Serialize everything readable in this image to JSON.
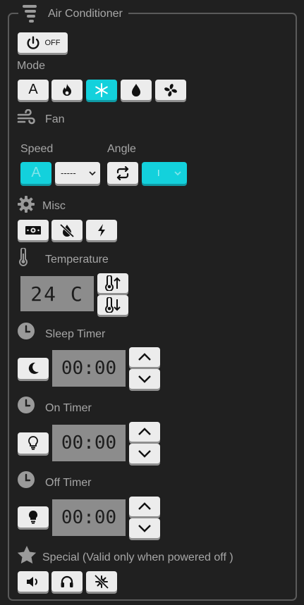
{
  "title": "Air Conditioner",
  "power": {
    "label": "OFF"
  },
  "mode": {
    "label": "Mode",
    "auto_label": "A",
    "selected": "cool"
  },
  "fan": {
    "label": "Fan",
    "speed_label": "Speed",
    "angle_label": "Angle",
    "speed_auto_label": "A",
    "angle_select_value": "-----",
    "angle_value_label": "I"
  },
  "misc": {
    "label": "Misc"
  },
  "temperature": {
    "label": "Temperature",
    "display": "24 C"
  },
  "sleep_timer": {
    "label": "Sleep Timer",
    "display": "00:00"
  },
  "on_timer": {
    "label": "On Timer",
    "display": "00:00"
  },
  "off_timer": {
    "label": "Off Timer",
    "display": "00:00"
  },
  "special": {
    "label": "Special (Valid only when powered off )"
  },
  "colors": {
    "active": "#13d1dc",
    "button": "#ececec",
    "lcd": "#8c8c8c",
    "background": "#202020"
  }
}
